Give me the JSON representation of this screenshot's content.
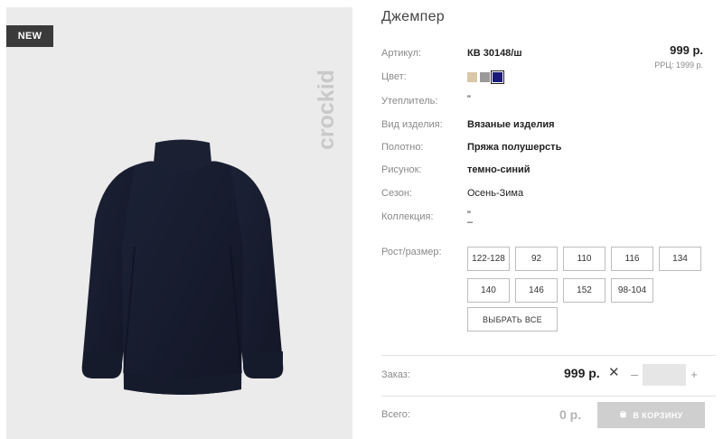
{
  "badge": "NEW",
  "brand": "crockid",
  "product": {
    "title": "Джемпер",
    "price": "999 р.",
    "rrp": "РРЦ: 1999 р.",
    "attributes": [
      {
        "label": "Артикул:",
        "value": "КВ 30148/ш",
        "bold": true
      },
      {
        "label": "Цвет:",
        "value": "",
        "bold": false
      },
      {
        "label": "Утеплитель:",
        "value": "\"",
        "bold": false
      },
      {
        "label": "Вид изделия:",
        "value": "Вязаные изделия",
        "bold": true
      },
      {
        "label": "Полотно:",
        "value": "Пряжа полушерсть",
        "bold": true
      },
      {
        "label": "Рисунок:",
        "value": "темно-синий",
        "bold": true
      },
      {
        "label": "Сезон:",
        "value": "Осень-Зима",
        "bold": false
      },
      {
        "label": "Коллекция:",
        "value": "\"",
        "value2": "–",
        "bold": false
      }
    ],
    "colors": [
      "#d9c7a6",
      "#9a9a9a",
      "#1a1a7a"
    ],
    "selected_color_index": 2
  },
  "sizes": {
    "label": "Рост/размер:",
    "options": [
      "122-128",
      "92",
      "110",
      "116",
      "134",
      "140",
      "146",
      "152",
      "98-104"
    ],
    "select_all": "ВЫБРАТЬ ВСЕ"
  },
  "order": {
    "label": "Заказ:",
    "price": "999 р.",
    "times": "✕",
    "minus": "–",
    "plus": "+",
    "quantity": ""
  },
  "total": {
    "label": "Всего:",
    "value": "0 р.",
    "cart_button": "В КОРЗИНУ"
  }
}
